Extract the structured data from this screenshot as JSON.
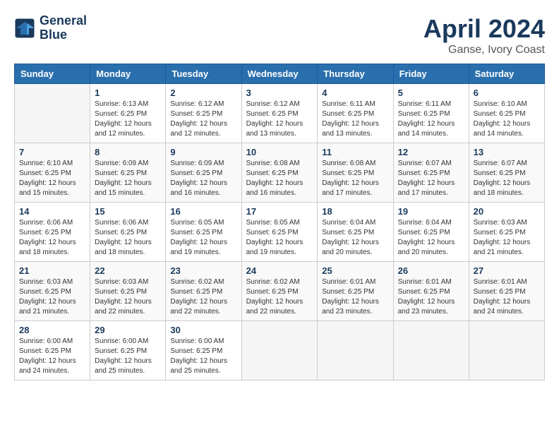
{
  "header": {
    "logo_line1": "General",
    "logo_line2": "Blue",
    "month_year": "April 2024",
    "location": "Ganse, Ivory Coast"
  },
  "weekdays": [
    "Sunday",
    "Monday",
    "Tuesday",
    "Wednesday",
    "Thursday",
    "Friday",
    "Saturday"
  ],
  "weeks": [
    [
      {
        "day": "",
        "info": ""
      },
      {
        "day": "1",
        "info": "Sunrise: 6:13 AM\nSunset: 6:25 PM\nDaylight: 12 hours\nand 12 minutes."
      },
      {
        "day": "2",
        "info": "Sunrise: 6:12 AM\nSunset: 6:25 PM\nDaylight: 12 hours\nand 12 minutes."
      },
      {
        "day": "3",
        "info": "Sunrise: 6:12 AM\nSunset: 6:25 PM\nDaylight: 12 hours\nand 13 minutes."
      },
      {
        "day": "4",
        "info": "Sunrise: 6:11 AM\nSunset: 6:25 PM\nDaylight: 12 hours\nand 13 minutes."
      },
      {
        "day": "5",
        "info": "Sunrise: 6:11 AM\nSunset: 6:25 PM\nDaylight: 12 hours\nand 14 minutes."
      },
      {
        "day": "6",
        "info": "Sunrise: 6:10 AM\nSunset: 6:25 PM\nDaylight: 12 hours\nand 14 minutes."
      }
    ],
    [
      {
        "day": "7",
        "info": "Sunrise: 6:10 AM\nSunset: 6:25 PM\nDaylight: 12 hours\nand 15 minutes."
      },
      {
        "day": "8",
        "info": "Sunrise: 6:09 AM\nSunset: 6:25 PM\nDaylight: 12 hours\nand 15 minutes."
      },
      {
        "day": "9",
        "info": "Sunrise: 6:09 AM\nSunset: 6:25 PM\nDaylight: 12 hours\nand 16 minutes."
      },
      {
        "day": "10",
        "info": "Sunrise: 6:08 AM\nSunset: 6:25 PM\nDaylight: 12 hours\nand 16 minutes."
      },
      {
        "day": "11",
        "info": "Sunrise: 6:08 AM\nSunset: 6:25 PM\nDaylight: 12 hours\nand 17 minutes."
      },
      {
        "day": "12",
        "info": "Sunrise: 6:07 AM\nSunset: 6:25 PM\nDaylight: 12 hours\nand 17 minutes."
      },
      {
        "day": "13",
        "info": "Sunrise: 6:07 AM\nSunset: 6:25 PM\nDaylight: 12 hours\nand 18 minutes."
      }
    ],
    [
      {
        "day": "14",
        "info": "Sunrise: 6:06 AM\nSunset: 6:25 PM\nDaylight: 12 hours\nand 18 minutes."
      },
      {
        "day": "15",
        "info": "Sunrise: 6:06 AM\nSunset: 6:25 PM\nDaylight: 12 hours\nand 18 minutes."
      },
      {
        "day": "16",
        "info": "Sunrise: 6:05 AM\nSunset: 6:25 PM\nDaylight: 12 hours\nand 19 minutes."
      },
      {
        "day": "17",
        "info": "Sunrise: 6:05 AM\nSunset: 6:25 PM\nDaylight: 12 hours\nand 19 minutes."
      },
      {
        "day": "18",
        "info": "Sunrise: 6:04 AM\nSunset: 6:25 PM\nDaylight: 12 hours\nand 20 minutes."
      },
      {
        "day": "19",
        "info": "Sunrise: 6:04 AM\nSunset: 6:25 PM\nDaylight: 12 hours\nand 20 minutes."
      },
      {
        "day": "20",
        "info": "Sunrise: 6:03 AM\nSunset: 6:25 PM\nDaylight: 12 hours\nand 21 minutes."
      }
    ],
    [
      {
        "day": "21",
        "info": "Sunrise: 6:03 AM\nSunset: 6:25 PM\nDaylight: 12 hours\nand 21 minutes."
      },
      {
        "day": "22",
        "info": "Sunrise: 6:03 AM\nSunset: 6:25 PM\nDaylight: 12 hours\nand 22 minutes."
      },
      {
        "day": "23",
        "info": "Sunrise: 6:02 AM\nSunset: 6:25 PM\nDaylight: 12 hours\nand 22 minutes."
      },
      {
        "day": "24",
        "info": "Sunrise: 6:02 AM\nSunset: 6:25 PM\nDaylight: 12 hours\nand 22 minutes."
      },
      {
        "day": "25",
        "info": "Sunrise: 6:01 AM\nSunset: 6:25 PM\nDaylight: 12 hours\nand 23 minutes."
      },
      {
        "day": "26",
        "info": "Sunrise: 6:01 AM\nSunset: 6:25 PM\nDaylight: 12 hours\nand 23 minutes."
      },
      {
        "day": "27",
        "info": "Sunrise: 6:01 AM\nSunset: 6:25 PM\nDaylight: 12 hours\nand 24 minutes."
      }
    ],
    [
      {
        "day": "28",
        "info": "Sunrise: 6:00 AM\nSunset: 6:25 PM\nDaylight: 12 hours\nand 24 minutes."
      },
      {
        "day": "29",
        "info": "Sunrise: 6:00 AM\nSunset: 6:25 PM\nDaylight: 12 hours\nand 25 minutes."
      },
      {
        "day": "30",
        "info": "Sunrise: 6:00 AM\nSunset: 6:25 PM\nDaylight: 12 hours\nand 25 minutes."
      },
      {
        "day": "",
        "info": ""
      },
      {
        "day": "",
        "info": ""
      },
      {
        "day": "",
        "info": ""
      },
      {
        "day": "",
        "info": ""
      }
    ]
  ]
}
